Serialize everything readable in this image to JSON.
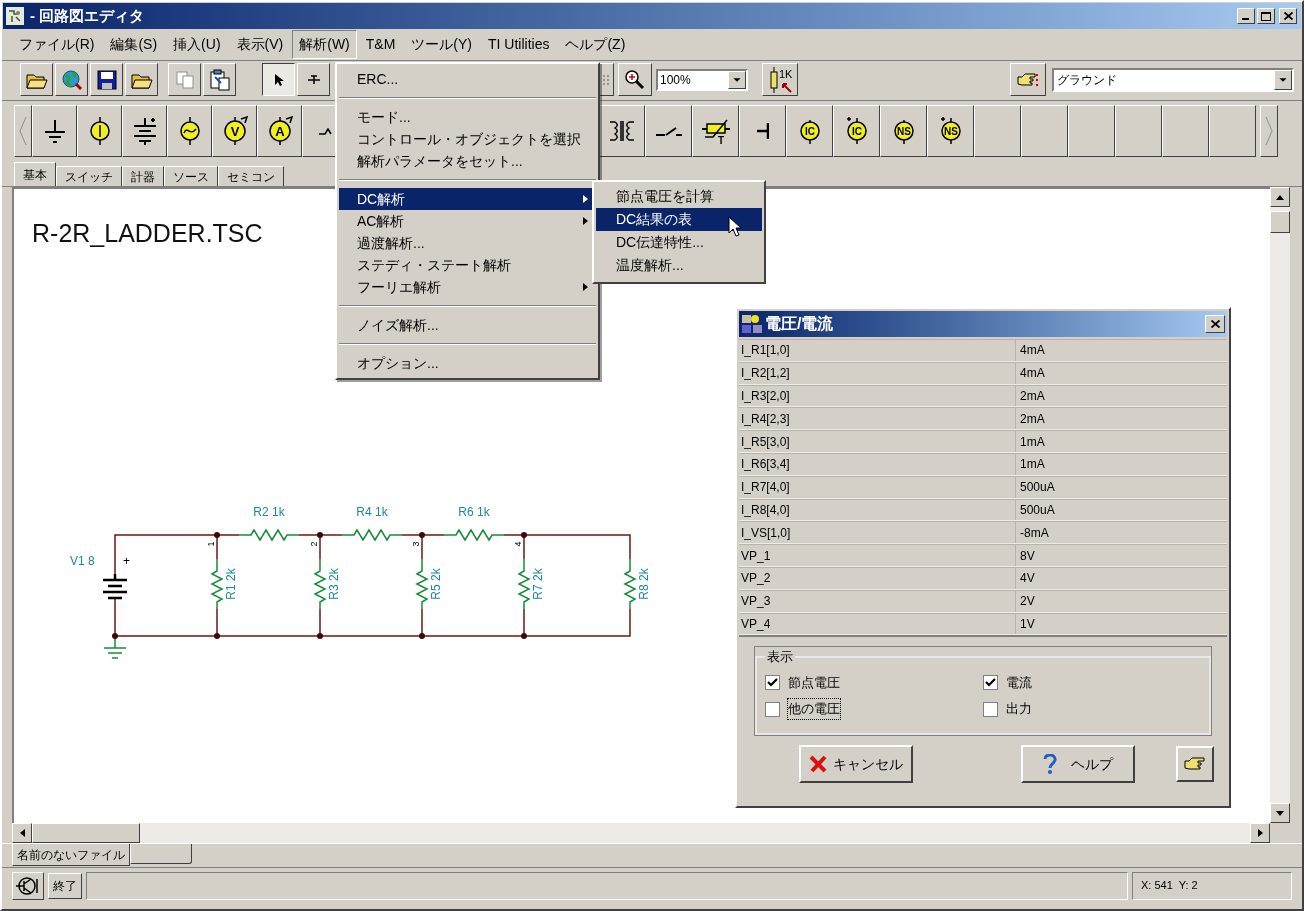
{
  "window": {
    "title": "- 回路図エディタ"
  },
  "menubar": [
    {
      "label": "ファイル(R)",
      "selected": false
    },
    {
      "label": "編集(S)",
      "selected": false
    },
    {
      "label": "挿入(U)",
      "selected": false
    },
    {
      "label": "表示(V)",
      "selected": false
    },
    {
      "label": "解析(W)",
      "selected": true
    },
    {
      "label": "T&M",
      "selected": false
    },
    {
      "label": "ツール(Y)",
      "selected": false
    },
    {
      "label": "TI Utilities",
      "selected": false
    },
    {
      "label": "ヘルプ(Z)",
      "selected": false
    }
  ],
  "toolbar": {
    "zoom": "100%",
    "resistor_button_label": "1K",
    "component_select": "グラウンド"
  },
  "palette_left": [
    {
      "kind": "ground"
    },
    {
      "kind": "current_source"
    },
    {
      "kind": "battery"
    },
    {
      "kind": "ac_source"
    },
    {
      "kind": "meter",
      "label": "V"
    },
    {
      "kind": "meter",
      "label": "A"
    },
    {
      "kind": "partial"
    }
  ],
  "palette_right": [
    {
      "kind": "transformer"
    },
    {
      "kind": "switch"
    },
    {
      "kind": "thermistor",
      "label": "T"
    },
    {
      "kind": "capacitor"
    },
    {
      "kind": "source",
      "label": "IC"
    },
    {
      "kind": "source_plus",
      "label": "IC"
    },
    {
      "kind": "source",
      "label": "NS"
    },
    {
      "kind": "source_plus",
      "label": "NS"
    },
    {
      "kind": "empty"
    },
    {
      "kind": "empty"
    },
    {
      "kind": "empty"
    },
    {
      "kind": "empty"
    },
    {
      "kind": "empty"
    },
    {
      "kind": "empty"
    }
  ],
  "component_tabs": [
    {
      "label": "基本",
      "selected": true
    },
    {
      "label": "スイッチ",
      "selected": false
    },
    {
      "label": "計器",
      "selected": false
    },
    {
      "label": "ソース",
      "selected": false
    },
    {
      "label": "セミコン",
      "selected": false
    }
  ],
  "schematic": {
    "title": "R-2R_LADDER.TSC",
    "source_label": "V1 8",
    "source_polarity": "+",
    "series_resistors": [
      "R2 1k",
      "R4 1k",
      "R6 1k"
    ],
    "shunt_resistors": [
      "R1 2k",
      "R3 2k",
      "R5 2k",
      "R7 2k",
      "R8 2k"
    ],
    "node_numbers": [
      "1",
      "2",
      "3",
      "4"
    ]
  },
  "analysis_menu": [
    {
      "kind": "item",
      "label": "ERC...",
      "selected": false
    },
    {
      "kind": "separator"
    },
    {
      "kind": "item",
      "label": "モード...",
      "selected": false
    },
    {
      "kind": "item",
      "label": "コントロール・オブジェクトを選択",
      "selected": false
    },
    {
      "kind": "item",
      "label": "解析パラメータをセット...",
      "selected": false
    },
    {
      "kind": "separator"
    },
    {
      "kind": "submenu",
      "label": "DC解析",
      "selected": true
    },
    {
      "kind": "submenu",
      "label": "AC解析",
      "selected": false
    },
    {
      "kind": "item",
      "label": "過渡解析...",
      "selected": false
    },
    {
      "kind": "item",
      "label": "ステディ・ステート解析",
      "selected": false
    },
    {
      "kind": "submenu",
      "label": "フーリエ解析",
      "selected": false
    },
    {
      "kind": "separator"
    },
    {
      "kind": "item",
      "label": "ノイズ解析...",
      "selected": false
    },
    {
      "kind": "separator"
    },
    {
      "kind": "item",
      "label": "オプション...",
      "selected": false
    }
  ],
  "dc_submenu": [
    {
      "label": "節点電圧を計算",
      "selected": false
    },
    {
      "label": "DC結果の表",
      "selected": true
    },
    {
      "label": "DC伝達特性...",
      "selected": false
    },
    {
      "label": "温度解析...",
      "selected": false
    }
  ],
  "dialog": {
    "title": "電圧/電流",
    "rows": [
      {
        "name": "I_R1[1,0]",
        "value": "4mA"
      },
      {
        "name": "I_R2[1,2]",
        "value": "4mA"
      },
      {
        "name": "I_R3[2,0]",
        "value": "2mA"
      },
      {
        "name": "I_R4[2,3]",
        "value": "2mA"
      },
      {
        "name": "I_R5[3,0]",
        "value": "1mA"
      },
      {
        "name": "I_R6[3,4]",
        "value": "1mA"
      },
      {
        "name": "I_R7[4,0]",
        "value": "500uA"
      },
      {
        "name": "I_R8[4,0]",
        "value": "500uA"
      },
      {
        "name": "I_VS[1,0]",
        "value": "-8mA"
      },
      {
        "name": "VP_1",
        "value": "8V"
      },
      {
        "name": "VP_2",
        "value": "4V"
      },
      {
        "name": "VP_3",
        "value": "2V"
      },
      {
        "name": "VP_4",
        "value": "1V"
      }
    ],
    "group_title": "表示",
    "options": [
      {
        "label": "節点電圧",
        "checked": true,
        "focused": false
      },
      {
        "label": "電流",
        "checked": true,
        "focused": false
      },
      {
        "label": "他の電圧",
        "checked": false,
        "focused": true
      },
      {
        "label": "出力",
        "checked": false,
        "focused": false
      }
    ],
    "buttons": [
      {
        "kind": "cancel",
        "label": "キャンセル"
      },
      {
        "kind": "help",
        "label": "ヘルプ"
      },
      {
        "kind": "pointer"
      }
    ]
  },
  "file_tabs": [
    {
      "label": "名前のないファイル",
      "selected": true
    }
  ],
  "status_bar": {
    "button": "終了",
    "coordinates": "X: 541  Y: 2"
  }
}
